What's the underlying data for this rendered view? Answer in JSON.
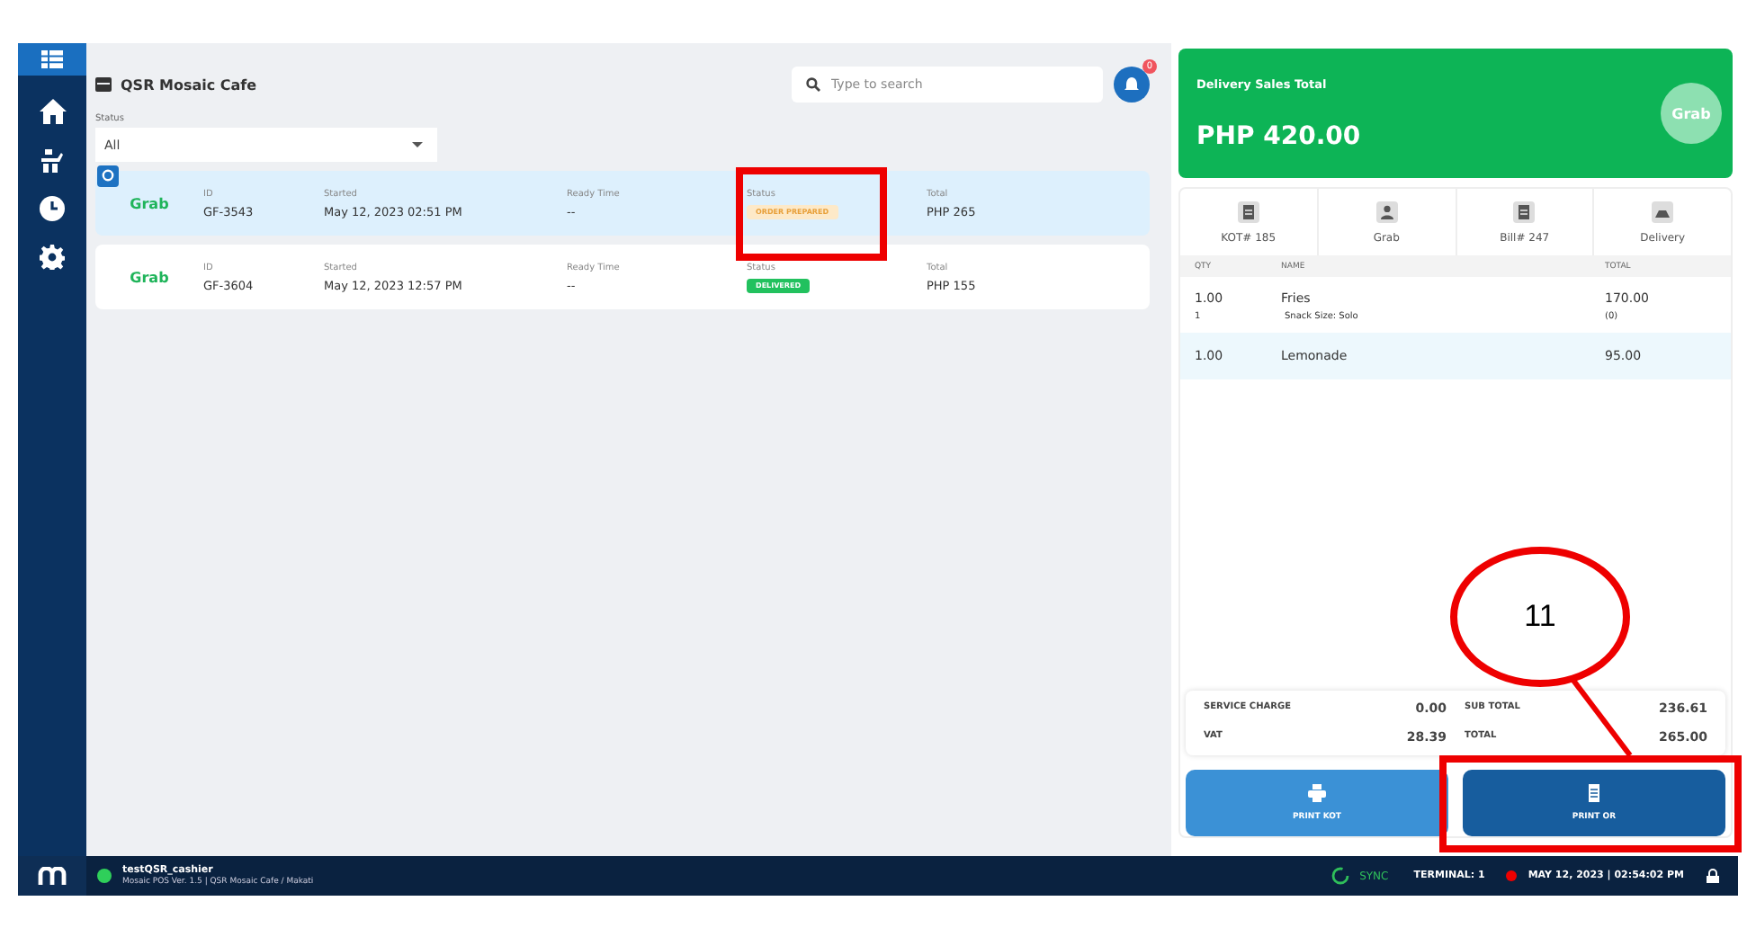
{
  "store": {
    "name": "QSR Mosaic Cafe"
  },
  "search": {
    "placeholder": "Type to search"
  },
  "notifications": {
    "badge": "0"
  },
  "filter": {
    "label": "Status",
    "value": "All"
  },
  "orders": [
    {
      "brand": "Grab",
      "pinned": true,
      "selected": true,
      "id_label": "ID",
      "id": "GF-3543",
      "started_label": "Started",
      "started": "May 12, 2023 02:51 PM",
      "ready_label": "Ready Time",
      "ready": "--",
      "status_label": "Status",
      "status": "ORDER PREPARED",
      "kind": "prepared",
      "total_label": "Total",
      "total": "PHP 265"
    },
    {
      "brand": "Grab",
      "pinned": false,
      "selected": false,
      "id_label": "ID",
      "id": "GF-3604",
      "started_label": "Started",
      "started": "May 12, 2023 12:57 PM",
      "ready_label": "Ready Time",
      "ready": "--",
      "status_label": "Status",
      "status": "DELIVERED",
      "kind": "delivered",
      "total_label": "Total",
      "total": "PHP 155"
    }
  ],
  "sales": {
    "title": "Delivery Sales Total",
    "amount": "PHP 420.00",
    "brand": "Grab"
  },
  "info": [
    {
      "kind": "kot",
      "label": "KOT# 185"
    },
    {
      "kind": "person",
      "label": "Grab"
    },
    {
      "kind": "bill",
      "label": "Bill# 247"
    },
    {
      "kind": "delivery",
      "label": "Delivery"
    }
  ],
  "items_table": {
    "columns": [
      "QTY",
      "NAME",
      "TOTAL"
    ],
    "rows": [
      {
        "qty": "1.00",
        "name": "Fries",
        "total": "170.00",
        "sub_qty": "1",
        "sub_name": "Snack Size: Solo",
        "sub_total": "(0)",
        "selected": false
      },
      {
        "qty": "1.00",
        "name": "Lemonade",
        "total": "95.00",
        "selected": true
      }
    ]
  },
  "summary": [
    {
      "label": "SERVICE CHARGE",
      "value": "0.00"
    },
    {
      "label": "SUB TOTAL",
      "value": "236.61"
    },
    {
      "label": "VAT",
      "value": "28.39"
    },
    {
      "label": "TOTAL",
      "value": "265.00"
    }
  ],
  "buttons": [
    {
      "kind": "kot",
      "label": "PRINT KOT"
    },
    {
      "kind": "bill",
      "label": "PRINT OR"
    }
  ],
  "status_bar": {
    "user": "testQSR_cashier",
    "online": true,
    "info": "Mosaic POS Ver. 1.5 | QSR Mosaic Cafe / Makati",
    "sync": "SYNC",
    "terminal": "TERMINAL: 1",
    "datetime": "MAY 12, 2023 | 02:54:02 PM"
  },
  "annotations": {
    "callout": "11"
  }
}
